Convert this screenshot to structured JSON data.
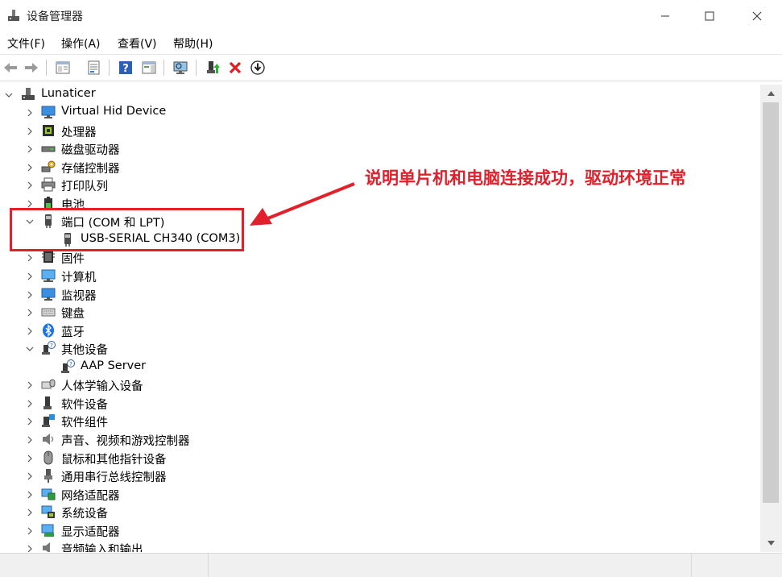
{
  "window": {
    "title": "设备管理器"
  },
  "menu": [
    "文件(F)",
    "操作(A)",
    "查看(V)",
    "帮助(H)"
  ],
  "tree": {
    "root": "Lunaticer",
    "items": [
      {
        "label": "Virtual Hid Device",
        "icon": "monitor-icon"
      },
      {
        "label": "处理器",
        "icon": "processor-icon"
      },
      {
        "label": "磁盘驱动器",
        "icon": "disk-drive-icon"
      },
      {
        "label": "存储控制器",
        "icon": "storage-controller-icon"
      },
      {
        "label": "打印队列",
        "icon": "printer-icon"
      },
      {
        "label": "电池",
        "icon": "battery-icon"
      },
      {
        "label": "端口 (COM 和 LPT)",
        "icon": "port-icon",
        "expanded": true,
        "children": [
          {
            "label": "USB-SERIAL CH340 (COM3)",
            "icon": "port-icon"
          }
        ]
      },
      {
        "label": "固件",
        "icon": "firmware-icon"
      },
      {
        "label": "计算机",
        "icon": "computer-icon"
      },
      {
        "label": "监视器",
        "icon": "monitor-icon"
      },
      {
        "label": "键盘",
        "icon": "keyboard-icon"
      },
      {
        "label": "蓝牙",
        "icon": "bluetooth-icon"
      },
      {
        "label": "其他设备",
        "icon": "unknown-device-icon",
        "expanded": true,
        "children": [
          {
            "label": "AAP Server",
            "icon": "unknown-device-icon"
          }
        ]
      },
      {
        "label": "人体学输入设备",
        "icon": "hid-icon"
      },
      {
        "label": "软件设备",
        "icon": "software-device-icon"
      },
      {
        "label": "软件组件",
        "icon": "software-component-icon"
      },
      {
        "label": "声音、视频和游戏控制器",
        "icon": "speaker-icon"
      },
      {
        "label": "鼠标和其他指针设备",
        "icon": "mouse-icon"
      },
      {
        "label": "通用串行总线控制器",
        "icon": "usb-icon"
      },
      {
        "label": "网络适配器",
        "icon": "network-adapter-icon"
      },
      {
        "label": "系统设备",
        "icon": "system-device-icon"
      },
      {
        "label": "显示适配器",
        "icon": "display-adapter-icon"
      },
      {
        "label": "音频输入和输出",
        "icon": "audio-io-icon"
      }
    ]
  },
  "annotation": {
    "text": "说明单片机和电脑连接成功，驱动环境正常"
  },
  "colors": {
    "accent": "#e0202a",
    "icon_blue": "#2a7fd4",
    "icon_dark": "#3c3c3c"
  }
}
